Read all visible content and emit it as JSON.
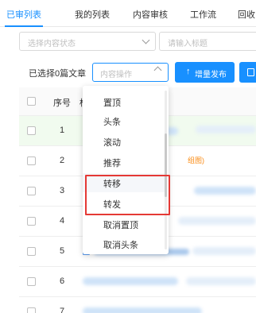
{
  "tabs": [
    {
      "label": "已审列表",
      "active": true
    },
    {
      "label": "我的列表",
      "active": false
    },
    {
      "label": "内容审核",
      "active": false
    },
    {
      "label": "工作流",
      "active": false
    },
    {
      "label": "回收",
      "active": false
    }
  ],
  "filters": {
    "status_placeholder": "选择内容状态",
    "title_placeholder": "请输入标题"
  },
  "toolbar": {
    "selected_count": "已选择0篇文章",
    "content_ops_placeholder": "内容操作",
    "add_publish_label": "增量发布",
    "add_publish_icon": "arrow-up-icon"
  },
  "table": {
    "headers": {
      "seq": "序号",
      "title": "标"
    },
    "rows": [
      {
        "seq": "1",
        "highlight": true
      },
      {
        "seq": "2",
        "tag": "组图)"
      },
      {
        "seq": "3"
      },
      {
        "seq": "4"
      },
      {
        "seq": "5"
      },
      {
        "seq": "6"
      },
      {
        "seq": "7"
      }
    ]
  },
  "dropdown": {
    "items": [
      "置顶",
      "头条",
      "滚动",
      "推荐",
      "转移",
      "转发",
      "取消置顶",
      "取消头条"
    ],
    "hover_index": 4
  },
  "colors": {
    "accent": "#1890ff",
    "annotation": "#e53935",
    "highlight_row": "#f1fbef",
    "tag": "#fa8c16"
  }
}
